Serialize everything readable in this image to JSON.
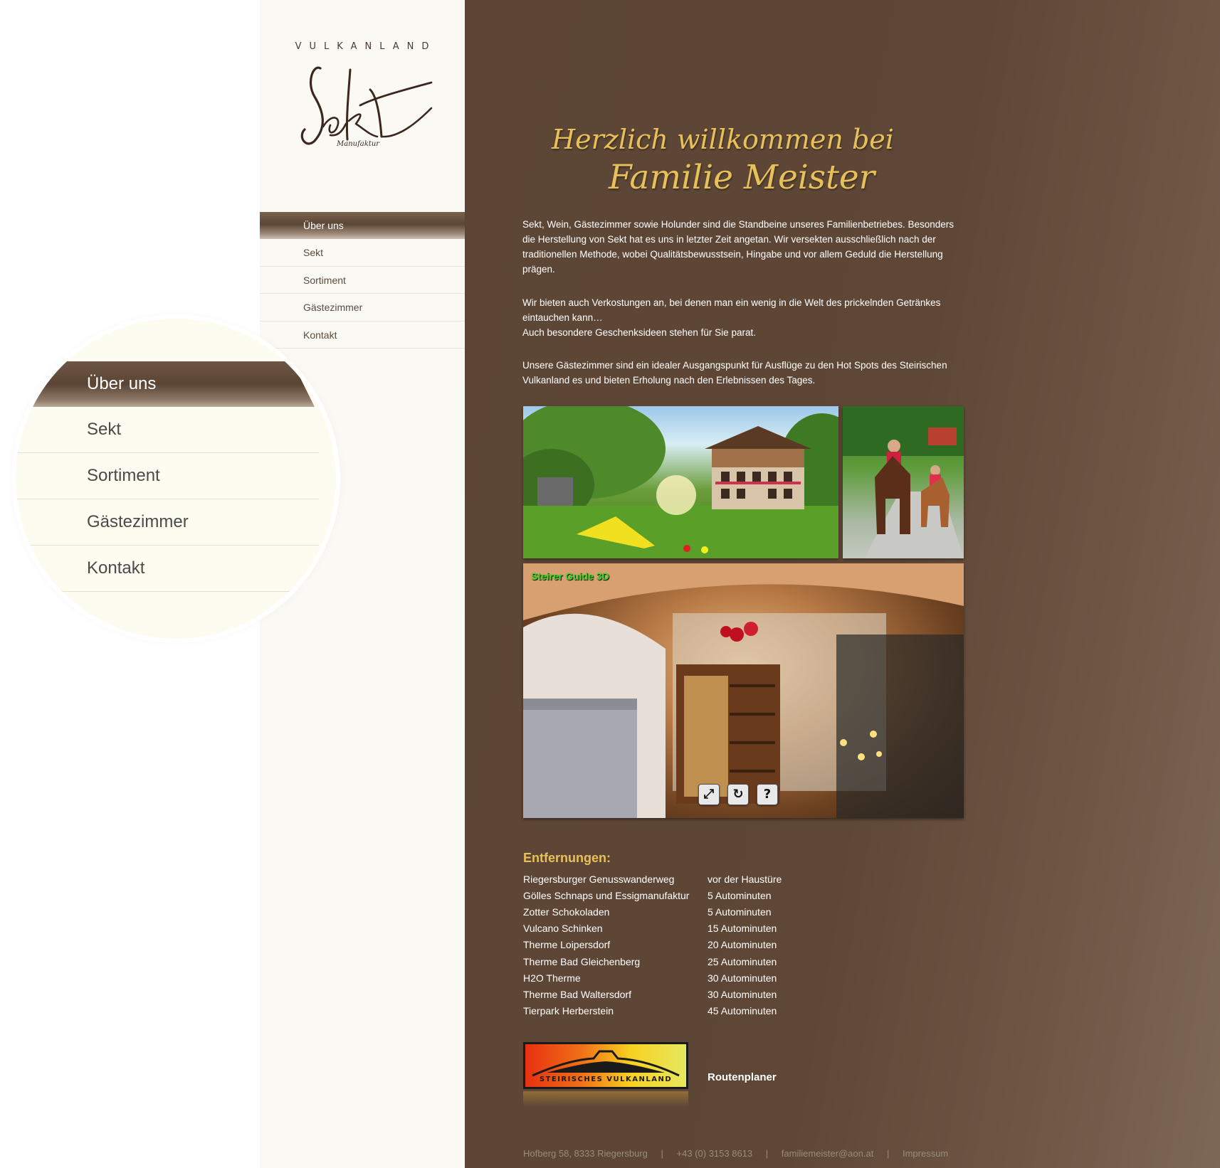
{
  "brand": {
    "top_text": "VULKANLAND",
    "logo_script": "Sekt",
    "logo_sub": "Manufaktur"
  },
  "nav": {
    "items": [
      {
        "label": "Über uns",
        "active": true
      },
      {
        "label": "Sekt"
      },
      {
        "label": "Sortiment"
      },
      {
        "label": "Gästezimmer"
      },
      {
        "label": "Kontakt"
      }
    ]
  },
  "welcome": {
    "line1": "Herzlich willkommen bei",
    "line2": "Familie Meister"
  },
  "intro": {
    "p1": "Sekt, Wein, Gästezimmer sowie Holunder sind die Standbeine unseres Familienbetriebes. Besonders die Herstellung von Sekt hat es uns in letzter Zeit angetan. Wir versekten ausschließlich nach der traditionellen Methode, wobei Qualitätsbewusstsein, Hingabe und vor allem Geduld die Herstellung prägen.",
    "p2a": "Wir bieten auch Verkostungen an, bei denen man ein wenig in die Welt des prickelnden Getränkes eintauchen kann…",
    "p2b": "Auch besondere Geschenksideen stehen für Sie parat.",
    "p3": "Unsere Gästezimmer sind ein idealer Ausgangspunkt für Ausflüge zu den Hot Spots des Steirischen Vulkanland es und bieten Erholung nach den Erlebnissen des Tages."
  },
  "tour": {
    "label": "Steirer Guide 3D"
  },
  "distances": {
    "heading": "Entfernungen:",
    "rows": [
      {
        "place": "Riegersburger Genusswanderweg",
        "time": "vor der Haustüre"
      },
      {
        "place": "Gölles Schnaps und Essigmanufaktur",
        "time": "5 Autominuten"
      },
      {
        "place": "Zotter Schokoladen",
        "time": "5 Autominuten"
      },
      {
        "place": "Vulcano Schinken",
        "time": "15 Autominuten"
      },
      {
        "place": "Therme Loipersdorf",
        "time": "20 Autominuten"
      },
      {
        "place": "Therme Bad Gleichenberg",
        "time": "25 Autominuten"
      },
      {
        "place": "H2O Therme",
        "time": "30 Autominuten"
      },
      {
        "place": "Therme Bad Waltersdorf",
        "time": "30 Autominuten"
      },
      {
        "place": "Tierpark Herberstein",
        "time": "45 Autominuten"
      }
    ]
  },
  "vulkanland_logo": {
    "text": "STEIRISCHES VULKANLAND"
  },
  "routenplaner": "Routenplaner",
  "footer": {
    "address": "Hofberg 58, 8333 Riegersburg",
    "phone": "+43 (0) 3153 8613",
    "email": "familiemeister@aon.at",
    "impressum": "Impressum",
    "separator": "|"
  },
  "colors": {
    "gold": "#e8c05a",
    "main_bg": "#5c4535",
    "sidebar_bg": "#fbf9f4",
    "zoom_bg": "#fdfcf0"
  }
}
